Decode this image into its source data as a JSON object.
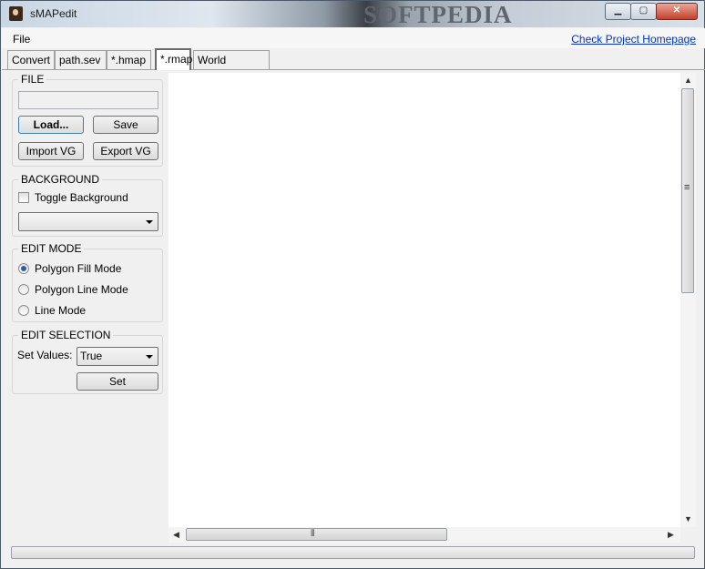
{
  "window": {
    "title": "sMAPedit",
    "watermark": "SOFTPEDIA",
    "controls": {
      "minimize": "▁",
      "maximize": "▢",
      "close": "✕"
    }
  },
  "menu": {
    "file": "File",
    "homepage_link": "Check Project Homepage"
  },
  "tabs": [
    {
      "label": "Convert",
      "active": false
    },
    {
      "label": "path.sev",
      "active": false
    },
    {
      "label": "*.hmap",
      "active": false
    },
    {
      "label": "*.rmap",
      "active": true
    },
    {
      "label": "World Explorer",
      "active": false
    }
  ],
  "file_group": {
    "title": "FILE",
    "path_value": "",
    "load_button": "Load...",
    "save_button": "Save",
    "import_button": "Import VG",
    "export_button": "Export VG"
  },
  "background_group": {
    "title": "BACKGROUND",
    "toggle_label": "Toggle Background",
    "toggle_checked": false,
    "select_value": ""
  },
  "edit_mode_group": {
    "title": "EDIT MODE",
    "options": [
      {
        "label": "Polygon Fill Mode",
        "checked": true
      },
      {
        "label": "Polygon Line Mode",
        "checked": false
      },
      {
        "label": "Line Mode",
        "checked": false
      }
    ]
  },
  "edit_selection_group": {
    "title": "EDIT SELECTION",
    "set_values_label": "Set Values:",
    "set_values_value": "True",
    "set_button": "Set"
  },
  "scrollbars": {
    "up_arrow": "▲",
    "down_arrow": "▼",
    "left_arrow": "◀",
    "right_arrow": "▶",
    "vgrip": "≡",
    "hgrip": "⦀"
  }
}
